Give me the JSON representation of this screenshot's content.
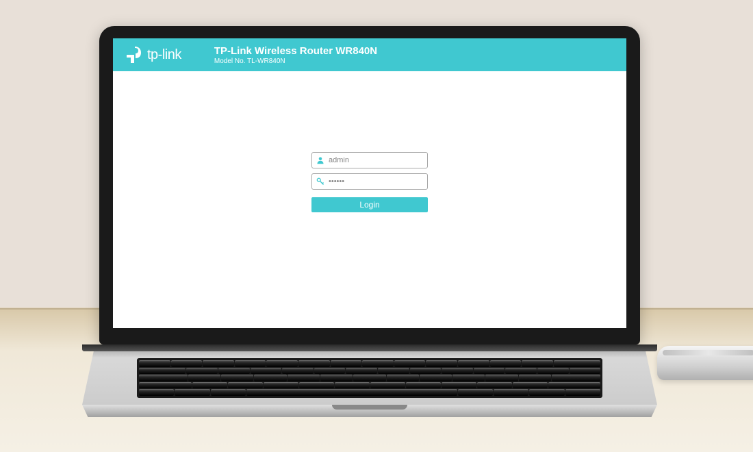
{
  "brand": "tp-link",
  "header": {
    "title": "TP-Link Wireless Router WR840N",
    "model": "Model No. TL-WR840N"
  },
  "login": {
    "username_value": "admin",
    "password_value": "••••••",
    "button_label": "Login"
  },
  "colors": {
    "accent": "#40c8d0"
  }
}
